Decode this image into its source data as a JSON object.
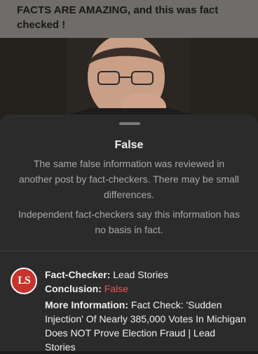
{
  "post": {
    "text": "FACTS ARE AMAZING,  and this was fact checked !"
  },
  "sheet": {
    "title": "False",
    "description": "The same false information was reviewed in another post by fact-checkers. There may be small differences.",
    "independent_note": "Independent fact-checkers say this information has no basis in fact."
  },
  "fact_checker": {
    "logo_letters": "LS",
    "checker_label": "Fact-Checker:",
    "checker_name": "Lead Stories",
    "conclusion_label": "Conclusion:",
    "conclusion_value": "False",
    "more_info_label": "More Information:",
    "more_info_text": "Fact Check: 'Sudden Injection' Of Nearly 385,000 Votes In Michigan Does NOT Prove Election Fraud | Lead Stories"
  },
  "colors": {
    "false_red": "#ef4f55",
    "logo_red": "#c9332c",
    "sheet_bg": "#2b2b2b"
  }
}
